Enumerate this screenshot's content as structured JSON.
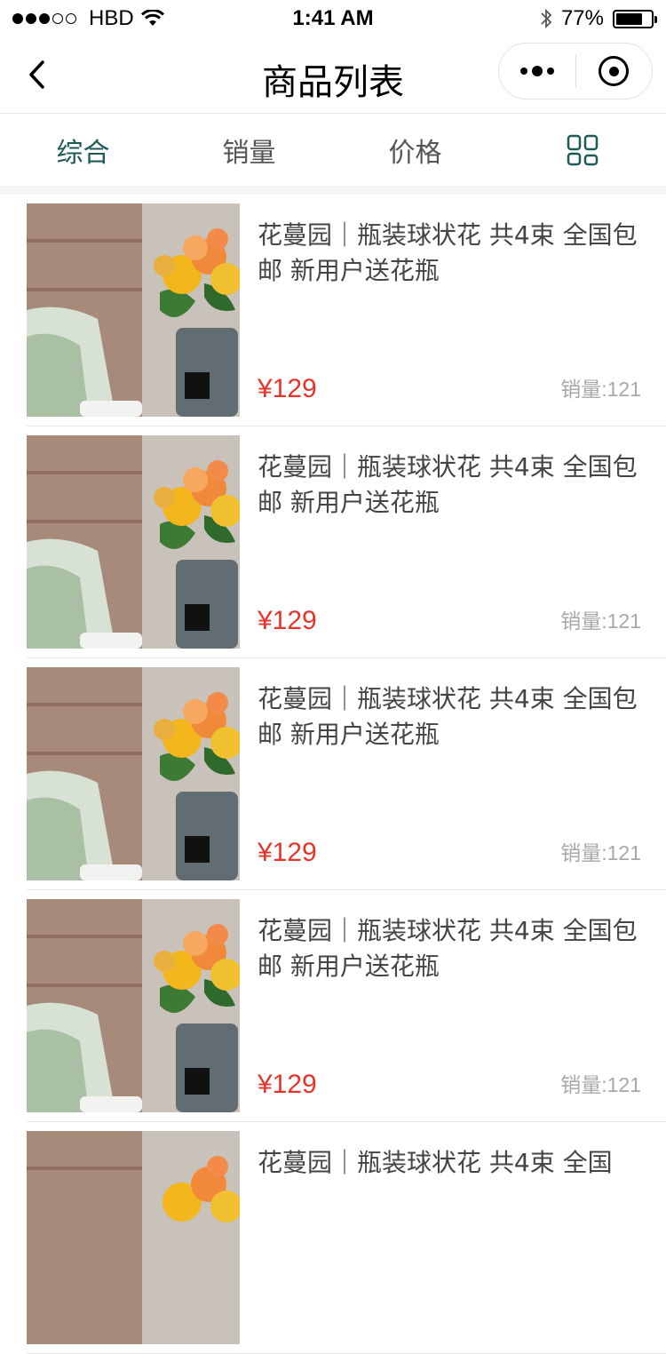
{
  "status_bar": {
    "carrier": "HBD",
    "time": "1:41 AM",
    "battery_percent": "77%",
    "battery_level": 0.77
  },
  "nav": {
    "title": "商品列表",
    "back_icon": "chevron-left-icon",
    "more_icon": "more-dots-icon",
    "close_icon": "target-circle-icon"
  },
  "filters": {
    "tabs": [
      "综合",
      "销量",
      "价格"
    ],
    "active_index": 0,
    "layout_toggle_icon": "grid-view-icon",
    "accent_color": "#1d5a57"
  },
  "products": [
    {
      "title": "花蔓园｜瓶装球状花 共4束 全国包邮 新用户送花瓶",
      "price": "¥129",
      "sales": "销量:121"
    },
    {
      "title": "花蔓园｜瓶装球状花 共4束 全国包邮 新用户送花瓶",
      "price": "¥129",
      "sales": "销量:121"
    },
    {
      "title": "花蔓园｜瓶装球状花 共4束 全国包邮 新用户送花瓶",
      "price": "¥129",
      "sales": "销量:121"
    },
    {
      "title": "花蔓园｜瓶装球状花 共4束 全国包邮 新用户送花瓶",
      "price": "¥129",
      "sales": "销量:121"
    },
    {
      "title": "花蔓园｜瓶装球状花 共4束 全国",
      "price": "",
      "sales": ""
    }
  ],
  "colors": {
    "price": "#e5352b",
    "sales": "#a8a8a8"
  }
}
